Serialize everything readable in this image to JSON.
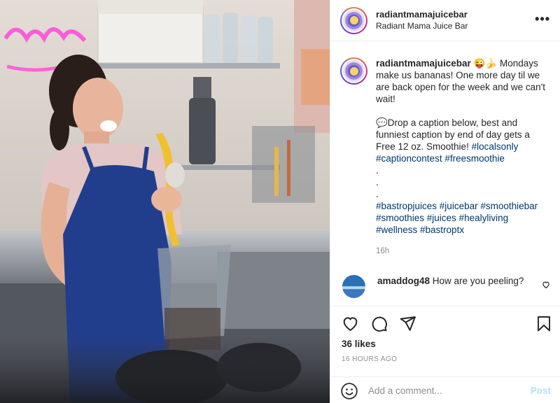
{
  "post": {
    "username": "radiantmamajuicebar",
    "location": "Radiant Mama Juice Bar",
    "more_label": "•••",
    "caption_emojis": "😜🍌",
    "caption_line1": " Mondays make us bananas! One more day til we are back open for the week and we can't wait!",
    "caption_contest": "💬Drop a caption below, best and funniest caption by end of day gets a Free 12 oz. Smoothie! ",
    "contest_tags": "#localsonly #captioncontest #freesmoothie",
    "dots": [
      ".",
      ".",
      "."
    ],
    "hashtags": "#bastropjuices #juicebar #smoothiebar #smoothies #juices #healyliving #wellness #bastroptx",
    "caption_time": "16h",
    "comment": {
      "username": "amaddog48",
      "text": " How are you peeling?"
    },
    "likes": "36 likes",
    "posted_ago": "16 HOURS AGO",
    "add_comment_placeholder": "Add a comment...",
    "post_label": "Post"
  },
  "icons": [
    "more-icon",
    "heart-icon",
    "comment-icon",
    "share-icon",
    "bookmark-icon",
    "emoji-icon",
    "comment-like-icon"
  ],
  "colors": {
    "hashtag": "#00376b",
    "post_button": "#b2dffc",
    "muted": "#8e8e8e"
  }
}
